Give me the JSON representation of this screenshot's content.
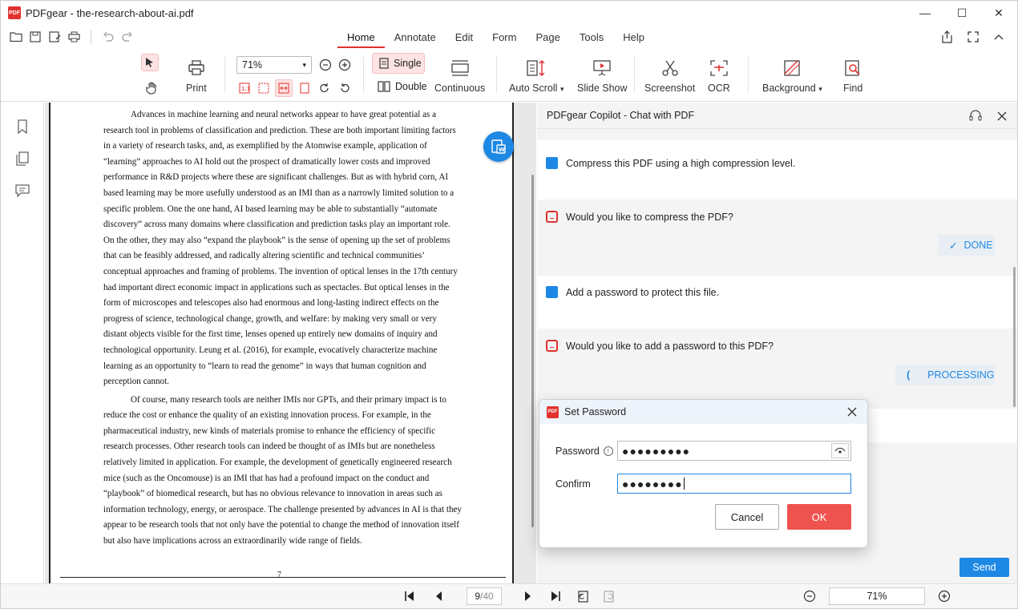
{
  "window": {
    "app_name": "PDFgear",
    "title": "PDFgear - the-research-about-ai.pdf",
    "minimize": "—",
    "maximize": "☐",
    "close": "✕"
  },
  "menu": {
    "tabs": [
      "Home",
      "Annotate",
      "Edit",
      "Form",
      "Page",
      "Tools",
      "Help"
    ],
    "active_tab": "Home"
  },
  "ribbon": {
    "print": "Print",
    "zoom_value": "71%",
    "single": "Single",
    "double": "Double",
    "continuous": "Continuous",
    "auto_scroll": "Auto Scroll",
    "slide_show": "Slide Show",
    "screenshot": "Screenshot",
    "ocr": "OCR",
    "background": "Background",
    "find": "Find"
  },
  "document": {
    "paragraphs": [
      "Advances in machine learning and neural networks appear to have great potential as a research tool in problems of classification and prediction.  These are both important limiting factors in a variety of research tasks, and, as exemplified by the Atomwise example, application of “learning” approaches to AI hold out the prospect of dramatically lower costs and improved performance in R&D projects where these are significant challenges.  But as with hybrid corn, AI based learning may be more usefully understood as an IMI than as a narrowly limited solution to a specific problem.  One the one hand, AI based learning may be able to substantially “automate discovery” across many domains where classification and prediction tasks play an important role.  On the other, they may also “expand the playbook” is the sense of opening up the set of problems that can be feasibly addressed, and radically altering  scientific and technical communities’ conceptual approaches and framing of problems.  The invention of optical lenses in the 17th century had important direct economic impact in applications such as spectacles.  But optical lenses in the form of microscopes and telescopes also had enormous and long-lasting indirect effects on the progress of science, technological change, growth, and welfare: by making very small or very distant objects visible for the first time, lenses opened up entirely new domains of inquiry and technological opportunity.  Leung et al. (2016), for example, evocatively characterize machine learning as an opportunity to “learn to read the genome” in ways that human cognition and perception cannot.",
      "Of course, many research tools are neither IMIs nor GPTs, and their primary impact is to reduce the cost or enhance the quality of an existing innovation process.  For example, in the pharmaceutical industry, new kinds of materials promise to enhance the efficiency of specific research processes.  Other research tools can indeed be thought of as IMIs but are nonetheless relatively limited in application.  For example, the development of genetically engineered research mice (such as the Oncomouse) is an IMI that has had a profound impact on the conduct and “playbook” of biomedical research, but has no obvious relevance to innovation in areas such as information technology, energy, or aerospace.  The challenge presented by advances in AI is that they appear to be research tools that not only have the potential to change the method of innovation itself but also have implications across an extraordinarily wide range of fields."
    ],
    "page_number": "7"
  },
  "copilot": {
    "title": "PDFgear Copilot - Chat with PDF",
    "messages": [
      {
        "role": "user",
        "text": "Compress this PDF using a high compression level."
      },
      {
        "role": "bot",
        "text": "Would you like to compress the PDF?",
        "status": "DONE"
      },
      {
        "role": "user",
        "text": "Add a password to protect this file."
      },
      {
        "role": "bot",
        "text": "Would you like to add a password to this PDF?",
        "status": "PROCESSING"
      }
    ],
    "send": "Send"
  },
  "bottombar": {
    "current_page": "9",
    "total_pages": "/40",
    "zoom": "71%"
  },
  "dialog": {
    "title": "Set Password",
    "password_label": "Password",
    "password_value": "●●●●●●●●●",
    "confirm_label": "Confirm",
    "confirm_value": "●●●●●●●●",
    "cancel": "Cancel",
    "ok": "OK"
  },
  "colors": {
    "accent_red": "#e0312d",
    "accent_blue": "#1e88e5",
    "ok_button": "#ef5350"
  }
}
